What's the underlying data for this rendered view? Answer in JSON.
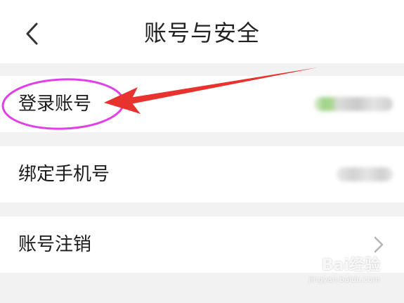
{
  "header": {
    "title": "账号与安全",
    "back_icon": "chevron-left-icon"
  },
  "rows": [
    {
      "label": "登录账号",
      "value_state": "blurred"
    },
    {
      "label": "绑定手机号",
      "value_state": "blurred"
    },
    {
      "label": "账号注销",
      "trailing_icon": "chevron-right-icon"
    }
  ],
  "annotation": {
    "highlight_target": "登录账号",
    "ellipse_color": "#e040e8",
    "arrow_color": "#e8322e"
  },
  "watermark": {
    "logo": "Bai经验",
    "sub": "jingyan.baidu.com"
  },
  "colors": {
    "background": "#f2f2f2",
    "surface": "#ffffff",
    "text": "#1a1a1a",
    "chevron": "#b5b5b5"
  }
}
